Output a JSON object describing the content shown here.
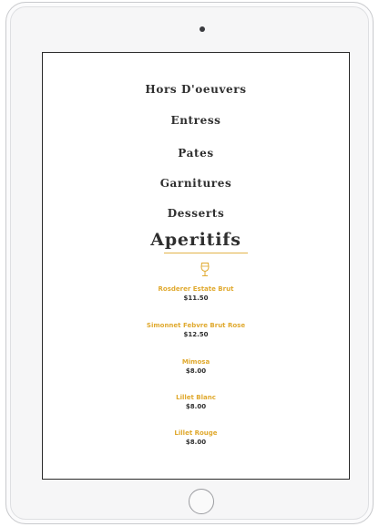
{
  "menu": {
    "categories": [
      {
        "label": "Hors D'oeuvers"
      },
      {
        "label": "Entress"
      },
      {
        "label": "Pates"
      },
      {
        "label": "Garnitures"
      },
      {
        "label": "Desserts"
      }
    ],
    "active_category": "Aperitifs",
    "section_icon": "champagne-glass-icon",
    "items": [
      {
        "name": "Rosderer Estate Brut",
        "price": "$11.50"
      },
      {
        "name": "Simonnet Febvre Brut Rose",
        "price": "$12.50"
      },
      {
        "name": "Mimosa",
        "price": "$8.00"
      },
      {
        "name": "Lillet Blanc",
        "price": "$8.00"
      },
      {
        "name": "Lillet Rouge",
        "price": "$8.00"
      }
    ]
  },
  "colors": {
    "accent": "#e0a92e",
    "text": "#2f2f2f",
    "device_frame": "#f6f6f7",
    "screen_border": "#2b2b2b"
  }
}
